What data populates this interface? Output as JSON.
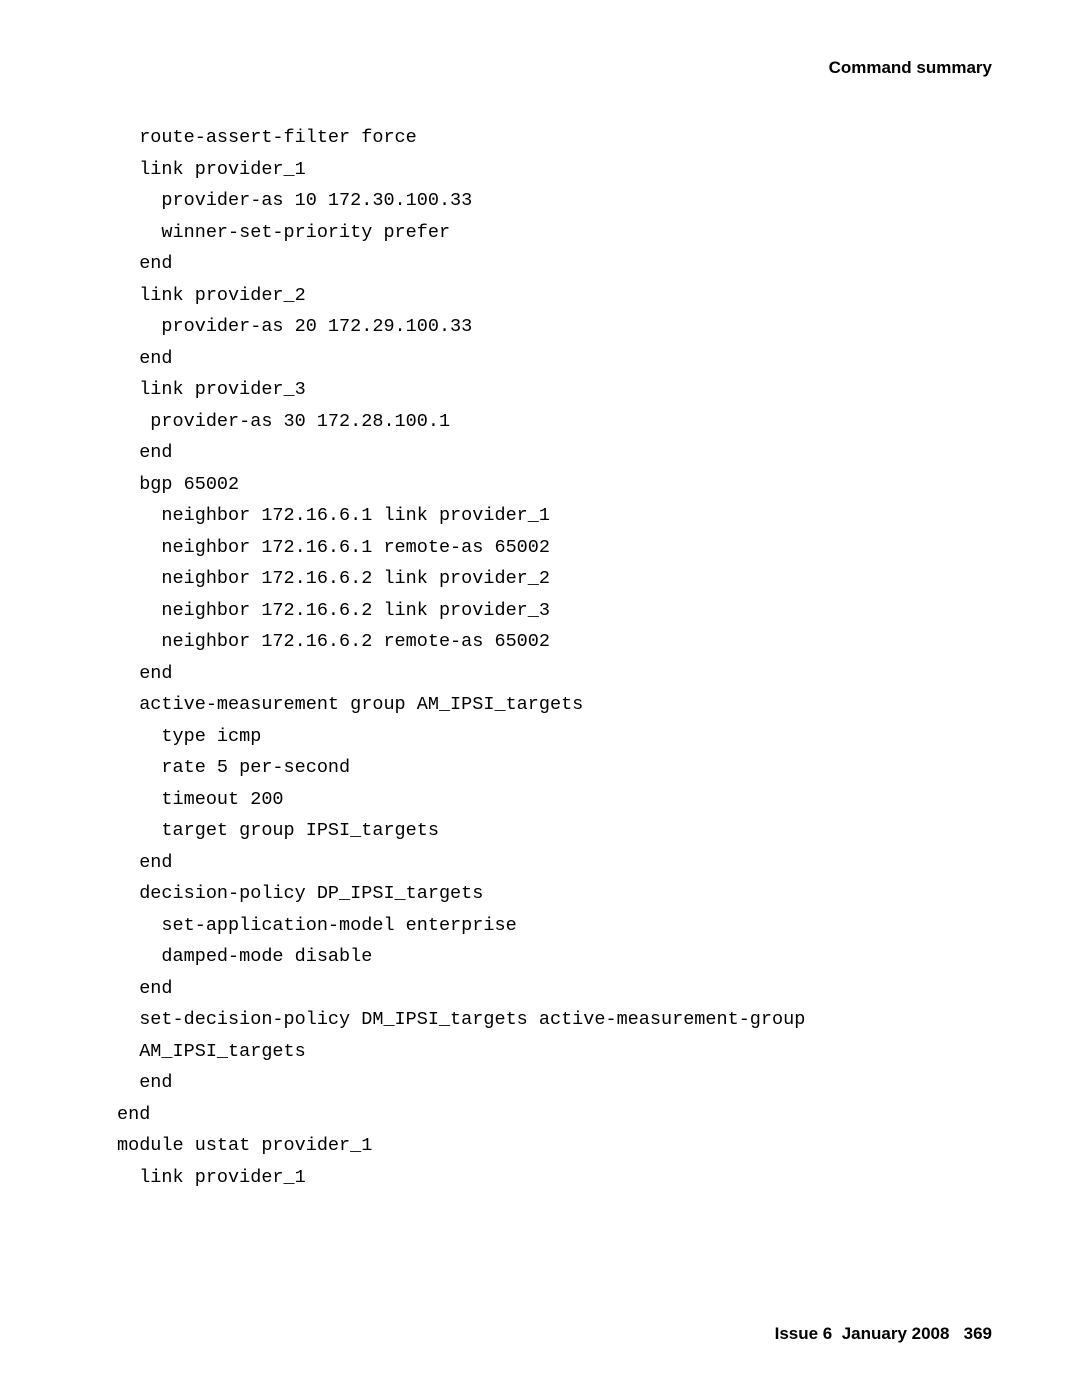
{
  "header": {
    "title": "Command summary"
  },
  "code": {
    "lines": [
      "  route-assert-filter force",
      "  link provider_1",
      "    provider-as 10 172.30.100.33",
      "    winner-set-priority prefer",
      "  end",
      "  link provider_2",
      "    provider-as 20 172.29.100.33",
      "  end",
      "  link provider_3",
      "   provider-as 30 172.28.100.1",
      "  end",
      "  bgp 65002",
      "    neighbor 172.16.6.1 link provider_1",
      "    neighbor 172.16.6.1 remote-as 65002",
      "    neighbor 172.16.6.2 link provider_2",
      "    neighbor 172.16.6.2 link provider_3",
      "    neighbor 172.16.6.2 remote-as 65002",
      "  end",
      "  active-measurement group AM_IPSI_targets",
      "    type icmp",
      "    rate 5 per-second",
      "    timeout 200",
      "    target group IPSI_targets",
      "  end",
      "  decision-policy DP_IPSI_targets",
      "    set-application-model enterprise",
      "    damped-mode disable",
      "  end",
      "  set-decision-policy DM_IPSI_targets active-measurement-group",
      "  AM_IPSI_targets",
      "  end",
      "end",
      "module ustat provider_1",
      "  link provider_1"
    ]
  },
  "footer": {
    "issue": "Issue 6",
    "date": "January 2008",
    "page": "369"
  }
}
